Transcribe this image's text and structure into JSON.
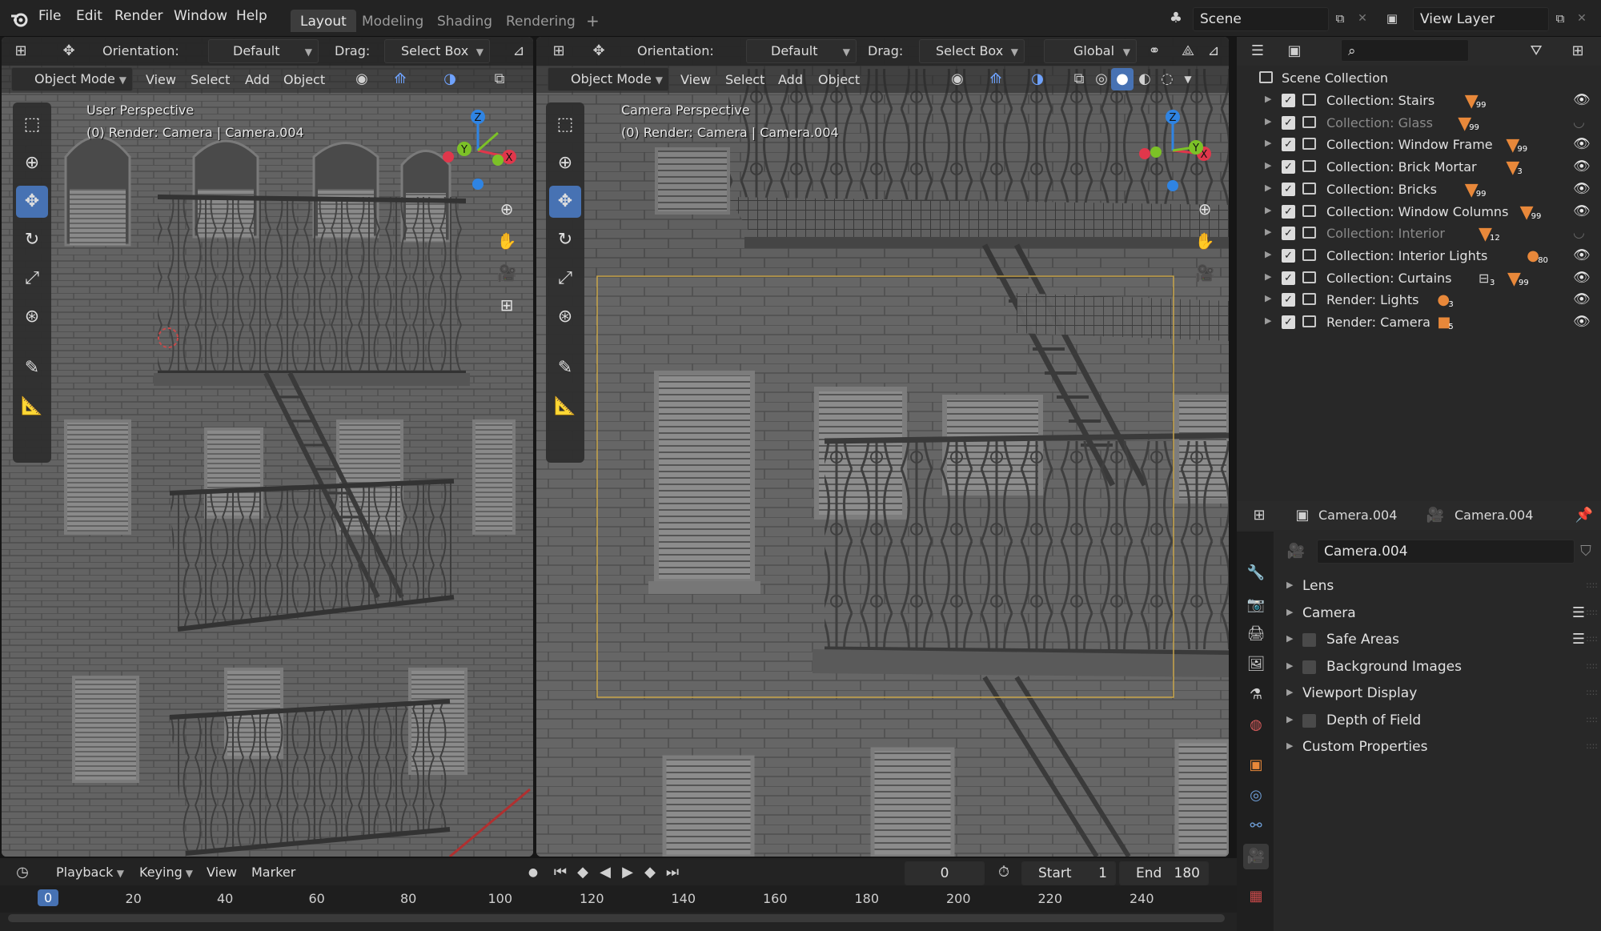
{
  "topbar": {
    "menus": [
      "File",
      "Edit",
      "Render",
      "Window",
      "Help"
    ],
    "workspaces": [
      "Layout",
      "Modeling",
      "Shading",
      "Rendering"
    ],
    "active_workspace": "Layout",
    "add_tab": "+",
    "scene": "Scene",
    "view_layer": "View Layer"
  },
  "left_viewport": {
    "orientation_label": "Orientation:",
    "orientation_value": "Default",
    "drag_label": "Drag:",
    "drag_value": "Select Box",
    "mode": "Object Mode",
    "menus": [
      "View",
      "Select",
      "Add",
      "Object"
    ],
    "perspective": "User Perspective",
    "context": "(0) Render: Camera | Camera.004",
    "gizmo": {
      "x": "X",
      "y": "Y",
      "z": "Z"
    }
  },
  "right_viewport": {
    "orientation_label": "Orientation:",
    "orientation_value": "Default",
    "drag_label": "Drag:",
    "drag_value": "Select Box",
    "transform": "Global",
    "mode": "Object Mode",
    "menus": [
      "View",
      "Select",
      "Add",
      "Object"
    ],
    "perspective": "Camera Perspective",
    "context": "(0) Render: Camera | Camera.004",
    "gizmo": {
      "x": "X",
      "y": "Y",
      "z": "Z"
    }
  },
  "outliner": {
    "root": "Scene Collection",
    "items": [
      {
        "name": "Collection: Stairs",
        "count": "99",
        "icon": "mesh",
        "dim": false
      },
      {
        "name": "Collection: Glass",
        "count": "99",
        "icon": "mesh",
        "dim": true
      },
      {
        "name": "Collection: Window Frame",
        "count": "99",
        "icon": "mesh",
        "dim": false
      },
      {
        "name": "Collection: Brick Mortar",
        "count": "3",
        "icon": "mesh",
        "dim": false
      },
      {
        "name": "Collection: Bricks",
        "count": "99",
        "icon": "mesh",
        "dim": false
      },
      {
        "name": "Collection: Window Columns",
        "count": "99",
        "icon": "mesh",
        "dim": false
      },
      {
        "name": "Collection: Interior",
        "count": "12",
        "icon": "mesh",
        "dim": true
      },
      {
        "name": "Collection: Interior Lights",
        "count": "80",
        "icon": "light",
        "dim": false
      },
      {
        "name": "Collection: Curtains",
        "count": "99",
        "extra_count": "3",
        "icon": "mesh",
        "dim": false
      },
      {
        "name": "Render: Lights",
        "count": "3",
        "icon": "light",
        "dim": false
      },
      {
        "name": "Render: Camera",
        "count": "5",
        "icon": "camera",
        "dim": false
      }
    ]
  },
  "properties": {
    "object_name": "Camera.004",
    "data_name": "Camera.004",
    "datablock": "Camera.004",
    "panels": [
      {
        "label": "Lens",
        "checkbox": false,
        "list": false
      },
      {
        "label": "Camera",
        "checkbox": false,
        "list": true
      },
      {
        "label": "Safe Areas",
        "checkbox": true,
        "list": true
      },
      {
        "label": "Background Images",
        "checkbox": true,
        "list": false
      },
      {
        "label": "Viewport Display",
        "checkbox": false,
        "list": false
      },
      {
        "label": "Depth of Field",
        "checkbox": true,
        "list": false
      },
      {
        "label": "Custom Properties",
        "checkbox": false,
        "list": false
      }
    ]
  },
  "timeline": {
    "menus": [
      "Playback",
      "Keying",
      "View",
      "Marker"
    ],
    "current_frame": "0",
    "start_label": "Start",
    "start": "1",
    "end_label": "End",
    "end": "180",
    "ruler": [
      "0",
      "20",
      "40",
      "60",
      "80",
      "100",
      "120",
      "140",
      "160",
      "180",
      "200",
      "220",
      "240"
    ]
  },
  "colors": {
    "accent": "#4772b3",
    "panel": "#282828",
    "header": "#232323",
    "mesh_icon": "#e8883a",
    "camera_frame": "#c9a54a",
    "gizmo_x": "#e0374b",
    "gizmo_y": "#7cc127",
    "gizmo_z": "#2f84e3"
  }
}
